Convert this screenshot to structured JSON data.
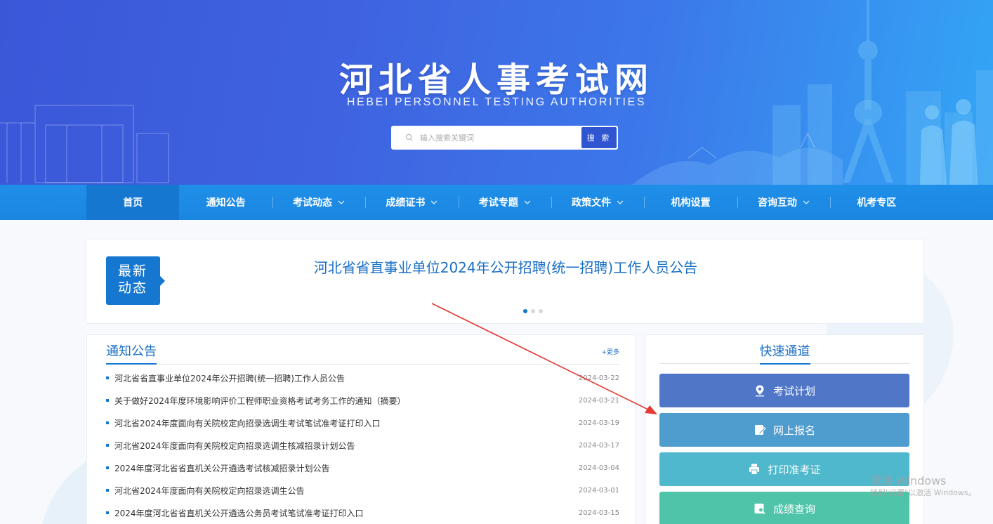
{
  "colors": {
    "banner_start": "#3a57d8",
    "banner_end": "#33a6f5",
    "nav_bg": "#1b86e2",
    "nav_active": "#1677d0",
    "accent": "#1677d0",
    "link": "#1a6fc4"
  },
  "banner": {
    "title": "河北省人事考试网",
    "subtitle": "HEBEI PERSONNEL TESTING AUTHORITIES"
  },
  "search": {
    "placeholder": "输入搜索关键词",
    "button_label": "搜 索",
    "icon": "search-icon"
  },
  "nav": {
    "items": [
      {
        "label": "首页",
        "dropdown": false,
        "active": true
      },
      {
        "label": "通知公告",
        "dropdown": false
      },
      {
        "label": "考试动态",
        "dropdown": true
      },
      {
        "label": "成绩证书",
        "dropdown": true
      },
      {
        "label": "考试专题",
        "dropdown": true
      },
      {
        "label": "政策文件",
        "dropdown": true
      },
      {
        "label": "机构设置",
        "dropdown": false
      },
      {
        "label": "咨询互动",
        "dropdown": true
      },
      {
        "label": "机考专区",
        "dropdown": false
      }
    ]
  },
  "latest": {
    "tag_line1": "最新",
    "tag_line2": "动态",
    "headline": "河北省省直事业单位2024年公开招聘(统一招聘)工作人员公告",
    "slide_count": 3,
    "active_slide": 1
  },
  "notice": {
    "title": "通知公告",
    "more": "+更多",
    "items": [
      {
        "text": "河北省省直事业单位2024年公开招聘(统一招聘)工作人员公告",
        "date": "2024-03-22"
      },
      {
        "text": "关于做好2024年度环境影响评价工程师职业资格考试考务工作的通知（摘要）",
        "date": "2024-03-21"
      },
      {
        "text": "河北省2024年度面向有关院校定向招录选调生考试笔试准考证打印入口",
        "date": "2024-03-19"
      },
      {
        "text": "河北省2024年度面向有关院校定向招录选调生核减招录计划公告",
        "date": "2024-03-17"
      },
      {
        "text": "2024年度河北省省直机关公开遴选考试核减招录计划公告",
        "date": "2024-03-04"
      },
      {
        "text": "河北省2024年度面向有关院校定向招录选调生公告",
        "date": "2024-03-01"
      },
      {
        "text": "2024年度河北省省直机关公开遴选公务员考试笔试准考证打印入口",
        "date": "2024-03-15"
      }
    ]
  },
  "quick": {
    "title": "快速通道",
    "buttons": [
      {
        "label": "考试计划",
        "icon": "location-pin-icon",
        "color": "#4f76c7"
      },
      {
        "label": "网上报名",
        "icon": "edit-form-icon",
        "color": "#4f9ccf"
      },
      {
        "label": "打印准考证",
        "icon": "printer-icon",
        "color": "#4fb8cc"
      },
      {
        "label": "成绩查询",
        "icon": "score-search-icon",
        "color": "#4fc4a9"
      }
    ]
  },
  "watermark": {
    "line1": "激活 Windows",
    "line2": "转到\"设置\"以激活 Windows。"
  }
}
